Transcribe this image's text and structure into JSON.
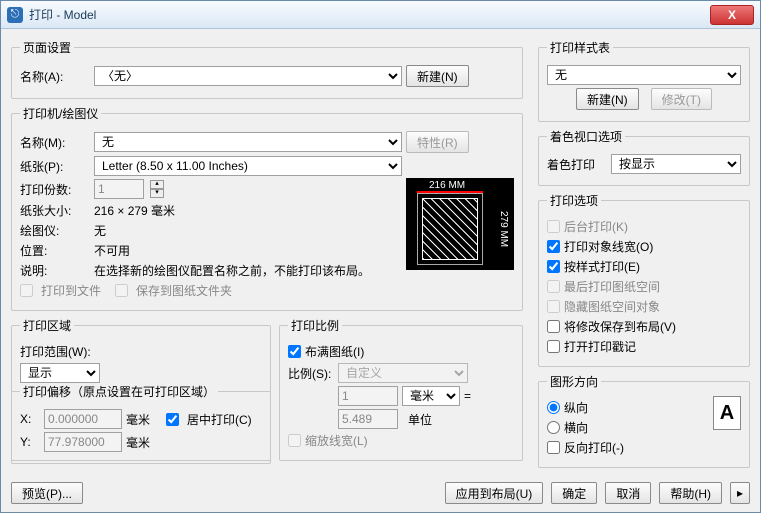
{
  "window": {
    "title": "打印 - Model",
    "close": "X"
  },
  "pageSetup": {
    "legend": "页面设置",
    "nameLabel": "名称(A):",
    "name": "〈无〉",
    "newBtn": "新建(N)"
  },
  "printer": {
    "legend": "打印机/绘图仪",
    "nameLabel": "名称(M):",
    "name": "无",
    "propBtn": "特性(R)",
    "paperLabel": "纸张(P):",
    "paper": "Letter (8.50 x 11.00 Inches)",
    "copiesLabel": "打印份数:",
    "copies": "1",
    "sizeLabel": "纸张大小:",
    "size": "216 × 279   毫米",
    "plotterLabel": "绘图仪:",
    "plotter": "无",
    "posLabel": "位置:",
    "pos": "不可用",
    "descLabel": "说明:",
    "desc": "在选择新的绘图仪配置名称之前，不能打印该布局。",
    "toFile": "打印到文件",
    "saveToSheet": "保存到图纸文件夹",
    "preview": {
      "w": "216 MM",
      "h": "279 MM"
    }
  },
  "area": {
    "legend": "打印区域",
    "rangeLabel": "打印范围(W):",
    "range": "显示"
  },
  "scale": {
    "legend": "打印比例",
    "fit": "布满图纸(I)",
    "ratioLabel": "比例(S):",
    "ratio": "自定义",
    "num": "1",
    "unitSel": "毫米",
    "eq": "=",
    "den": "5.489",
    "unitLabel": "单位",
    "scaleLW": "缩放线宽(L)"
  },
  "offset": {
    "legend": "打印偏移（原点设置在可打印区域）",
    "xLabel": "X:",
    "x": "0.000000",
    "mm": "毫米",
    "yLabel": "Y:",
    "y": "77.978000",
    "center": "居中打印(C)"
  },
  "styleTable": {
    "legend": "打印样式表",
    "value": "无",
    "newBtn": "新建(N)",
    "editBtn": "修改(T)"
  },
  "viewport": {
    "legend": "着色视口选项",
    "shadeLabel": "着色打印",
    "shade": "按显示"
  },
  "options": {
    "legend": "打印选项",
    "bg": "后台打印(K)",
    "lw": "打印对象线宽(O)",
    "style": "按样式打印(E)",
    "paperLast": "最后打印图纸空间",
    "hidePaper": "隐藏图纸空间对象",
    "saveLayout": "将修改保存到布局(V)",
    "stamp": "打开打印戳记"
  },
  "orient": {
    "legend": "图形方向",
    "portrait": "纵向",
    "landscape": "横向",
    "reverse": "反向打印(-)",
    "icon": "A"
  },
  "footer": {
    "preview": "预览(P)...",
    "applyLayout": "应用到布局(U)",
    "ok": "确定",
    "cancel": "取消",
    "help": "帮助(H)",
    "more": "▸"
  }
}
